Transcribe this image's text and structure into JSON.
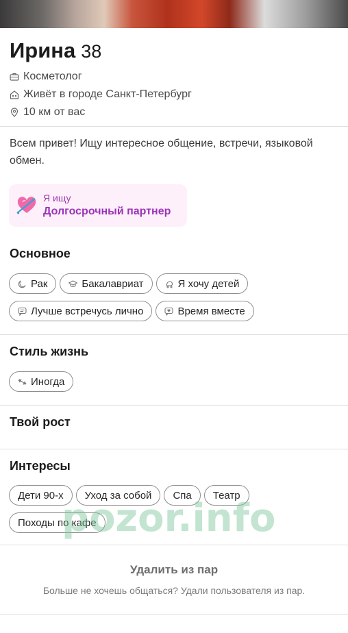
{
  "profile": {
    "name": "Ирина",
    "age": "38",
    "job": "Косметолог",
    "city": "Живёт в городе Санкт-Петербург",
    "distance": "10 км от вас",
    "bio": "Всем привет! Ищу интересное общение, встречи, языковой обмен."
  },
  "looking": {
    "label": "Я ищу",
    "value": "Долгосрочный партнер",
    "icon": "heart-arrow-icon"
  },
  "basics": {
    "title": "Основное",
    "chips": [
      {
        "label": "Рак",
        "icon": "moon-icon"
      },
      {
        "label": "Бакалавриат",
        "icon": "graduation-cap-icon"
      },
      {
        "label": "Я хочу детей",
        "icon": "baby-icon"
      },
      {
        "label": "Лучше встречусь лично",
        "icon": "chat-icon"
      },
      {
        "label": "Время вместе",
        "icon": "heart-chat-icon"
      }
    ]
  },
  "lifestyle": {
    "title": "Стиль жизнь",
    "chips": [
      {
        "label": "Иногда",
        "icon": "dumbbell-icon"
      }
    ]
  },
  "height": {
    "title": "Твой рост"
  },
  "interests": {
    "title": "Интересы",
    "chips": [
      "Дети 90-х",
      "Уход за собой",
      "Спа",
      "Театр",
      "Походы по кафе"
    ]
  },
  "remove": {
    "title": "Удалить из пар",
    "subtitle": "Больше не хочешь общаться? Удали пользователя из пар."
  },
  "watermark": "pozor.info",
  "colors": {
    "looking_bg": "#fdf0fb",
    "looking_accent": "#9b33b8",
    "chip_border": "#8e8e8e",
    "divider": "#dedede",
    "watermark": "#78c496"
  }
}
